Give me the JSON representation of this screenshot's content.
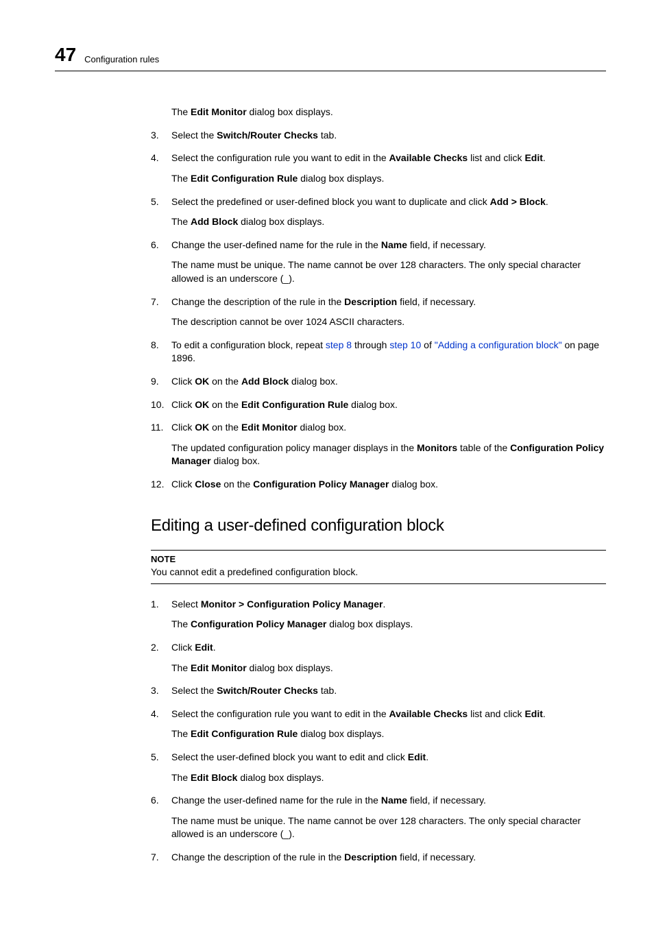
{
  "header": {
    "number": "47",
    "title": "Configuration rules"
  },
  "intro_sub": {
    "pre": "The ",
    "b1": "Edit Monitor",
    "post": " dialog box displays."
  },
  "steps": [
    {
      "num": "3.",
      "segments": [
        {
          "t": "Select the "
        },
        {
          "t": "Switch/Router Checks",
          "bold": true
        },
        {
          "t": " tab."
        }
      ]
    },
    {
      "num": "4.",
      "segments": [
        {
          "t": "Select the configuration rule you want to edit in the "
        },
        {
          "t": "Available Checks",
          "bold": true
        },
        {
          "t": " list and click "
        },
        {
          "t": "Edit",
          "bold": true
        },
        {
          "t": "."
        }
      ],
      "sub": [
        {
          "t": "The "
        },
        {
          "t": "Edit Configuration Rule",
          "bold": true
        },
        {
          "t": " dialog box displays."
        }
      ]
    },
    {
      "num": "5.",
      "segments": [
        {
          "t": "Select the predefined or user-defined block you want to duplicate and click "
        },
        {
          "t": "Add > Block",
          "bold": true
        },
        {
          "t": "."
        }
      ],
      "sub": [
        {
          "t": "The "
        },
        {
          "t": "Add Block",
          "bold": true
        },
        {
          "t": " dialog box displays."
        }
      ]
    },
    {
      "num": "6.",
      "segments": [
        {
          "t": "Change the user-defined name for the rule in the "
        },
        {
          "t": "Name",
          "bold": true
        },
        {
          "t": " field, if necessary."
        }
      ],
      "sub": [
        {
          "t": "The name must be unique. The name cannot be over 128 characters. The only special character allowed is an underscore (_)."
        }
      ]
    },
    {
      "num": "7.",
      "segments": [
        {
          "t": "Change the description of the rule in the "
        },
        {
          "t": "Description",
          "bold": true
        },
        {
          "t": " field, if necessary."
        }
      ],
      "sub": [
        {
          "t": "The description cannot be over 1024 ASCII characters."
        }
      ]
    },
    {
      "num": "8.",
      "segments": [
        {
          "t": "To edit a configuration block, repeat "
        },
        {
          "t": "step 8",
          "link": true
        },
        {
          "t": " through "
        },
        {
          "t": "step 10",
          "link": true
        },
        {
          "t": " of "
        },
        {
          "t": "\"Adding a configuration block\"",
          "link": true
        },
        {
          "t": " on page 1896."
        }
      ]
    },
    {
      "num": "9.",
      "segments": [
        {
          "t": "Click "
        },
        {
          "t": "OK",
          "bold": true
        },
        {
          "t": " on the "
        },
        {
          "t": "Add Block",
          "bold": true
        },
        {
          "t": " dialog box."
        }
      ]
    },
    {
      "num": "10.",
      "segments": [
        {
          "t": "Click "
        },
        {
          "t": "OK",
          "bold": true
        },
        {
          "t": " on the "
        },
        {
          "t": "Edit Configuration Rule",
          "bold": true
        },
        {
          "t": " dialog box."
        }
      ]
    },
    {
      "num": "11.",
      "segments": [
        {
          "t": "Click "
        },
        {
          "t": "OK",
          "bold": true
        },
        {
          "t": " on the "
        },
        {
          "t": "Edit Monitor",
          "bold": true
        },
        {
          "t": " dialog box."
        }
      ],
      "sub": [
        {
          "t": "The updated configuration policy manager displays in the "
        },
        {
          "t": "Monitors",
          "bold": true
        },
        {
          "t": " table of the "
        },
        {
          "t": "Configuration Policy Manager",
          "bold": true
        },
        {
          "t": " dialog box."
        }
      ]
    },
    {
      "num": "12.",
      "segments": [
        {
          "t": "Click "
        },
        {
          "t": "Close",
          "bold": true
        },
        {
          "t": " on the "
        },
        {
          "t": "Configuration Policy Manager",
          "bold": true
        },
        {
          "t": " dialog box."
        }
      ]
    }
  ],
  "section_heading": "Editing a user-defined configuration block",
  "note": {
    "label": "NOTE",
    "text": "You cannot edit a predefined configuration block."
  },
  "steps2": [
    {
      "num": "1.",
      "segments": [
        {
          "t": "Select "
        },
        {
          "t": "Monitor > Configuration Policy Manager",
          "bold": true
        },
        {
          "t": "."
        }
      ],
      "sub": [
        {
          "t": "The "
        },
        {
          "t": "Configuration Policy Manager",
          "bold": true
        },
        {
          "t": " dialog box displays."
        }
      ]
    },
    {
      "num": "2.",
      "segments": [
        {
          "t": "Click "
        },
        {
          "t": "Edit",
          "bold": true
        },
        {
          "t": "."
        }
      ],
      "sub": [
        {
          "t": "The "
        },
        {
          "t": "Edit Monitor",
          "bold": true
        },
        {
          "t": " dialog box displays."
        }
      ]
    },
    {
      "num": "3.",
      "segments": [
        {
          "t": "Select the "
        },
        {
          "t": "Switch/Router Checks",
          "bold": true
        },
        {
          "t": " tab."
        }
      ]
    },
    {
      "num": "4.",
      "segments": [
        {
          "t": "Select the configuration rule you want to edit in the "
        },
        {
          "t": "Available Checks",
          "bold": true
        },
        {
          "t": " list and click "
        },
        {
          "t": "Edit",
          "bold": true
        },
        {
          "t": "."
        }
      ],
      "sub": [
        {
          "t": "The "
        },
        {
          "t": "Edit Configuration Rule",
          "bold": true
        },
        {
          "t": " dialog box displays."
        }
      ]
    },
    {
      "num": "5.",
      "segments": [
        {
          "t": "Select the user-defined block you want to edit and click "
        },
        {
          "t": "Edit",
          "bold": true
        },
        {
          "t": "."
        }
      ],
      "sub": [
        {
          "t": "The "
        },
        {
          "t": "Edit Block",
          "bold": true
        },
        {
          "t": " dialog box displays."
        }
      ]
    },
    {
      "num": "6.",
      "segments": [
        {
          "t": "Change the user-defined name for the rule in the "
        },
        {
          "t": "Name",
          "bold": true
        },
        {
          "t": " field, if necessary."
        }
      ],
      "sub": [
        {
          "t": "The name must be unique. The name cannot be over 128 characters. The only special character allowed is an underscore (_)."
        }
      ]
    },
    {
      "num": "7.",
      "segments": [
        {
          "t": "Change the description of the rule in the "
        },
        {
          "t": "Description",
          "bold": true
        },
        {
          "t": " field, if necessary."
        }
      ]
    }
  ]
}
